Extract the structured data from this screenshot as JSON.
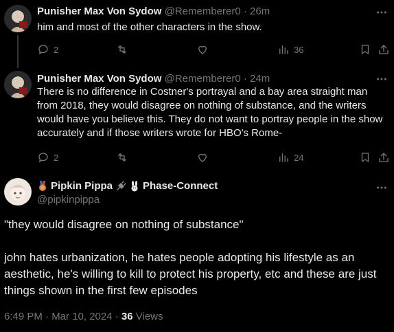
{
  "replies": [
    {
      "name": "Punisher Max Von Sydow",
      "handle": "@Rememberer0",
      "dot": "·",
      "time": "26m",
      "text": "him and most of the other characters in the show.",
      "replies_count": "2",
      "views": "36"
    },
    {
      "name": "Punisher Max Von Sydow",
      "handle": "@Rememberer0",
      "dot": "·",
      "time": "24m",
      "text": "There is no difference in Costner's portrayal and a bay area straight man from 2018, they would disagree on nothing of substance, and the writers would have you believe this. They do not want to portray people in the show accurately and if those writers wrote for HBO's Rome-",
      "replies_count": "2",
      "views": "24"
    }
  ],
  "main": {
    "name_part1": "Pipkin Pippa",
    "name_part2": "Phase-Connect",
    "handle": "@pipkinpippa",
    "quote_line": "\"they would disagree on nothing of substance\"",
    "body": "john hates urbanization, he  hates people adopting his lifestyle as an aesthetic, he's willing to kill to protect his property,  etc and these are just things shown in the first few episodes",
    "timestamp": "6:49 PM · Mar 10, 2024 · ",
    "views_count": "36",
    "views_label": " Views"
  },
  "colors": {
    "background": "#000000",
    "text": "#e7e9ea",
    "muted": "#71767b",
    "divider": "#2f3336"
  }
}
